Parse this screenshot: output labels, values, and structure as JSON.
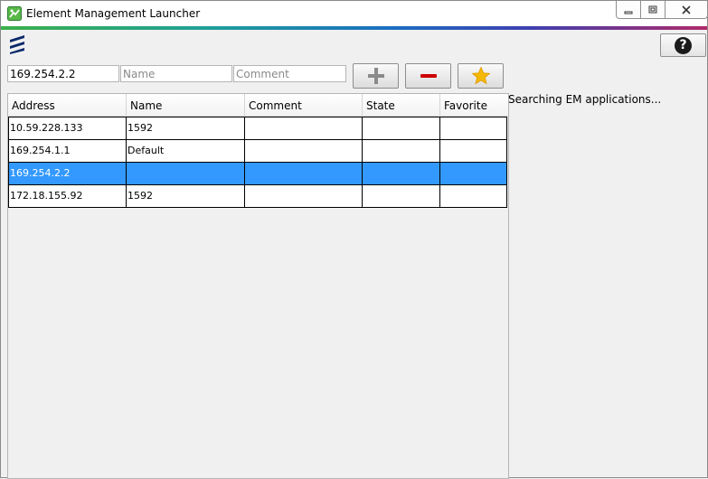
{
  "window": {
    "title": "Element Management Launcher",
    "icon": "green-launcher-icon",
    "controls": [
      "minimize-icon",
      "maximize-icon",
      "close-icon"
    ]
  },
  "colors": {
    "accent_gradient": [
      "#3bb04a",
      "#1f9e9a",
      "#1a6fc0",
      "#3f3fb0",
      "#b02a6a"
    ],
    "selection": "#3399ff",
    "remove_icon": "#cc0000",
    "favorite_icon": "#f5b800",
    "add_icon": "#8a8a8a"
  },
  "toolbar": {
    "address_value": "169.254.2.2",
    "address_placeholder": "",
    "name_value": "",
    "name_placeholder": "Name",
    "comment_value": "",
    "comment_placeholder": "Comment",
    "add_icon": "plus-icon",
    "remove_icon": "minus-icon",
    "favorite_icon": "star-icon"
  },
  "help": {
    "label": "?"
  },
  "table": {
    "columns": [
      "Address",
      "Name",
      "Comment",
      "State",
      "Favorite"
    ],
    "rows": [
      {
        "address": "10.59.228.133",
        "name": "1592",
        "comment": "",
        "state": "",
        "favorite": ""
      },
      {
        "address": "169.254.1.1",
        "name": "Default",
        "comment": "",
        "state": "",
        "favorite": ""
      },
      {
        "address": "169.254.2.2",
        "name": "",
        "comment": "",
        "state": "",
        "favorite": "",
        "selected": true
      },
      {
        "address": "172.18.155.92",
        "name": "1592",
        "comment": "",
        "state": "",
        "favorite": ""
      }
    ]
  },
  "status": {
    "text": "Searching EM applications..."
  }
}
